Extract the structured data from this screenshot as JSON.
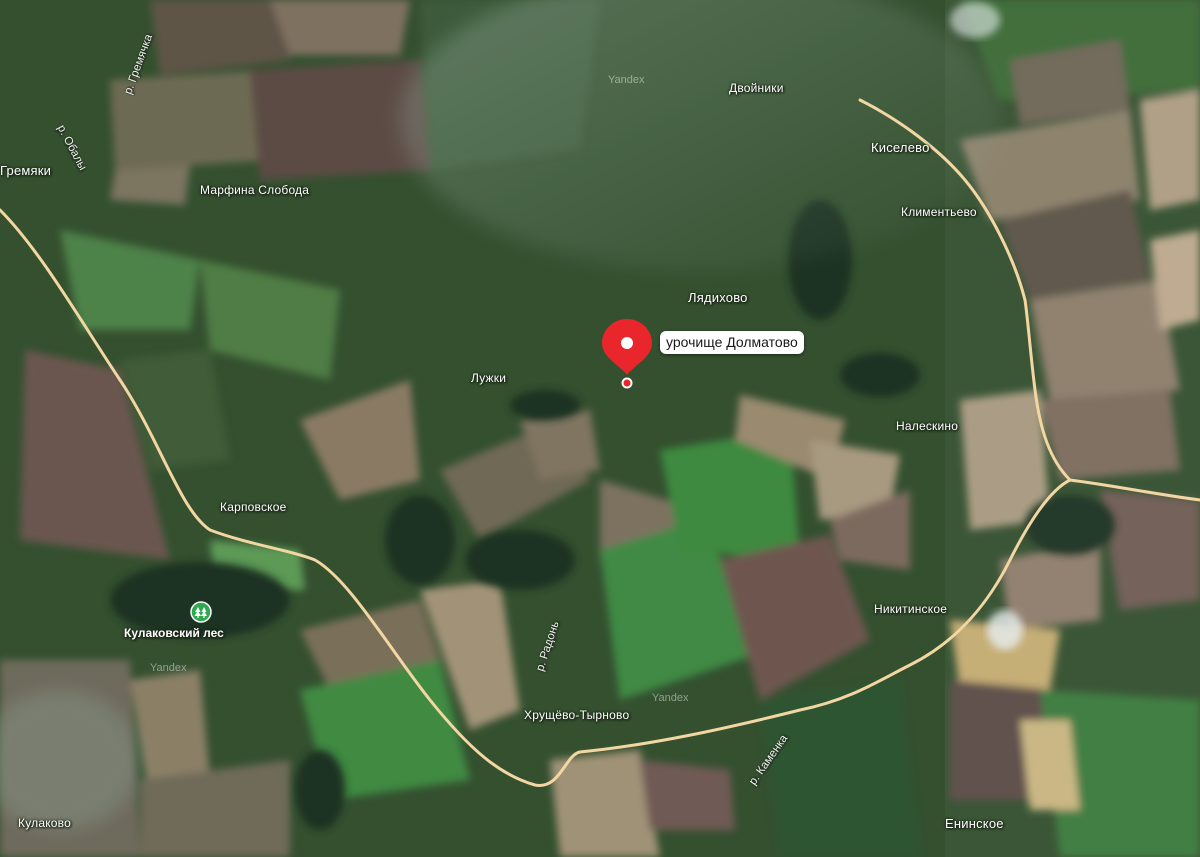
{
  "map": {
    "watermark": "Yandex",
    "selected_place": "урочище Долматово",
    "poi": {
      "label": "Кулаковский лес",
      "icon": "park-tree-icon"
    },
    "settlements": {
      "gremyaki": "Гремяки",
      "marfina": "Марфина Слобода",
      "dvoyniki": "Двойники",
      "kiselevo": "Киселево",
      "klimentevo": "Климентьево",
      "lyadikhovo": "Лядихово",
      "luzhki": "Лужки",
      "naleskino": "Налескино",
      "karpovskoe": "Карповское",
      "nikitinskoe": "Никитинское",
      "khrushchevo": "Хрущёво-Тырново",
      "kulakovo": "Кулаково",
      "eninskoe": "Енинское"
    },
    "rivers": {
      "gremyachka": "р. Гремячка",
      "obaly": "р. Обалы",
      "radon": "р. Радонь",
      "kamenka": "р. Каменка"
    },
    "colors": {
      "pin": "#e8262b",
      "road": "#f3d7a3"
    }
  }
}
